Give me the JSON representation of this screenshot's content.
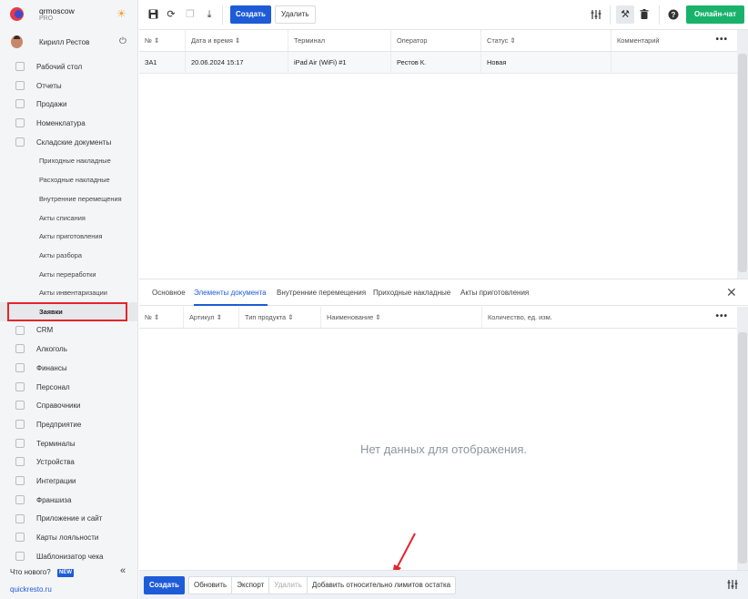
{
  "brand": {
    "name": "qrmoscow",
    "plan": "PRO"
  },
  "user": {
    "name": "Кирилл Рестов"
  },
  "sidebar": {
    "items": [
      {
        "label": "Рабочий стол",
        "icon": "dashboard-icon"
      },
      {
        "label": "Отчеты",
        "icon": "chart-icon"
      },
      {
        "label": "Продажи",
        "icon": "basket-icon"
      },
      {
        "label": "Номенклатура",
        "icon": "tag-icon"
      },
      {
        "label": "Складские документы",
        "icon": "warehouse-icon"
      }
    ],
    "sub_items": [
      "Приходные накладные",
      "Расходные накладные",
      "Внутренние перемещения",
      "Акты списания",
      "Акты приготовления",
      "Акты разбора",
      "Акты переработки",
      "Акты инвентаризации",
      "Заявки"
    ],
    "active_sub": "Заявки",
    "items_after": [
      {
        "label": "CRM",
        "icon": "crm-icon"
      },
      {
        "label": "Алкоголь",
        "icon": "glass-icon"
      },
      {
        "label": "Финансы",
        "icon": "wallet-icon"
      },
      {
        "label": "Персонал",
        "icon": "people-icon"
      },
      {
        "label": "Справочники",
        "icon": "book-icon"
      },
      {
        "label": "Предприятие",
        "icon": "building-icon"
      },
      {
        "label": "Терминалы",
        "icon": "terminal-icon"
      },
      {
        "label": "Устройства",
        "icon": "printer-icon"
      },
      {
        "label": "Интеграции",
        "icon": "link-icon"
      },
      {
        "label": "Франшиза",
        "icon": "franchise-icon"
      },
      {
        "label": "Приложение и сайт",
        "icon": "app-icon"
      },
      {
        "label": "Карты лояльности",
        "icon": "card-icon"
      },
      {
        "label": "Шаблонизатор чека",
        "icon": "receipt-icon"
      }
    ],
    "whats_new": "Что нового?",
    "new_badge": "NEW",
    "collapse": "«",
    "site": "quickresto.ru"
  },
  "toolbar": {
    "create": "Создать",
    "delete": "Удалить",
    "chat": "Онлайн-чат"
  },
  "grid": {
    "columns": [
      "№ ⇕",
      "Дата и время ⇕",
      "Терминал",
      "Оператор",
      "Статус ⇕",
      "Комментарий"
    ],
    "more": "•••",
    "rows": [
      [
        "ЗА1",
        "20.06.2024 15:17",
        "iPad Air (WiFi) #1",
        "Рестов К.",
        "Новая",
        ""
      ]
    ]
  },
  "detail": {
    "tabs": [
      "Основное",
      "Элементы документа",
      "Внутренние перемещения",
      "Приходные накладные",
      "Акты приготовления"
    ],
    "active_tab": "Элементы документа",
    "close": "✕",
    "columns": [
      "№ ⇕",
      "Артикул ⇕",
      "Тип продукта ⇕",
      "Наименование ⇕",
      "Количество, ед. изм."
    ],
    "more": "•••",
    "empty": "Нет данных для отображения."
  },
  "bottom": {
    "create": "Создать",
    "buttons": [
      "Обновить",
      "Экспорт",
      "Удалить",
      "Добавить относительно лимитов остатка"
    ],
    "disabled": [
      "Удалить"
    ]
  },
  "colors": {
    "accent": "#1e5bd7",
    "chat": "#19b26b",
    "highlight": "#e3252b"
  }
}
